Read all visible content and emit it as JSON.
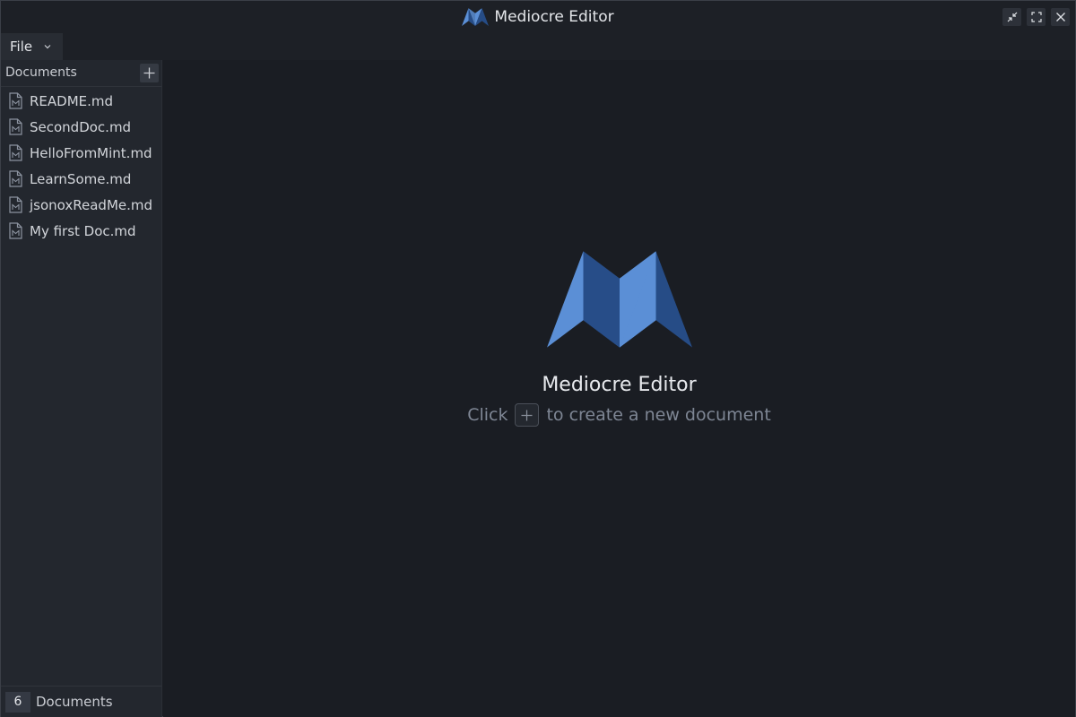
{
  "app": {
    "title": "Mediocre Editor",
    "accent_color": "#5b8fd6",
    "accent_dark": "#264c86"
  },
  "window_controls": [
    {
      "name": "restore-icon"
    },
    {
      "name": "fullscreen-icon"
    },
    {
      "name": "close-icon"
    }
  ],
  "menu": {
    "file_label": "File"
  },
  "sidebar": {
    "title": "Documents",
    "add_icon": "plus-icon",
    "documents": [
      {
        "label": "README.md",
        "icon": "markdown-file-icon"
      },
      {
        "label": "SecondDoc.md",
        "icon": "markdown-file-icon"
      },
      {
        "label": "HelloFromMint.md",
        "icon": "markdown-file-icon"
      },
      {
        "label": "LearnSome.md",
        "icon": "markdown-file-icon"
      },
      {
        "label": "jsonoxReadMe.md",
        "icon": "markdown-file-icon"
      },
      {
        "label": "My first Doc.md",
        "icon": "markdown-file-icon"
      }
    ],
    "footer": {
      "count": "6",
      "label": "Documents"
    }
  },
  "welcome": {
    "title": "Mediocre Editor",
    "hint_before": "Click",
    "hint_after": "to create a new document"
  }
}
